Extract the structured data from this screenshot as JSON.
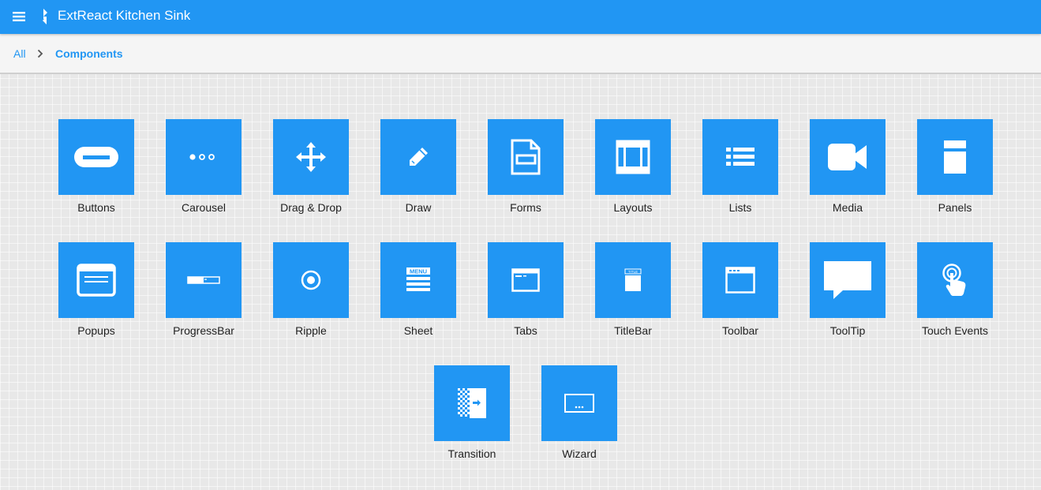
{
  "header": {
    "title": "ExtReact Kitchen Sink",
    "menu_icon": "menu-icon",
    "logo_icon": "sencha-logo-icon",
    "background_color": "#2196f3"
  },
  "breadcrumb": {
    "items": [
      {
        "label": "All"
      },
      {
        "label": "Components"
      }
    ],
    "separator_icon": "chevron-right-icon"
  },
  "components": {
    "accent_color": "#2196f3",
    "items": [
      {
        "label": "Buttons",
        "icon": "button-icon"
      },
      {
        "label": "Carousel",
        "icon": "carousel-icon"
      },
      {
        "label": "Drag & Drop",
        "icon": "drag-drop-icon"
      },
      {
        "label": "Draw",
        "icon": "pencil-icon"
      },
      {
        "label": "Forms",
        "icon": "form-icon"
      },
      {
        "label": "Layouts",
        "icon": "layout-icon"
      },
      {
        "label": "Lists",
        "icon": "list-icon"
      },
      {
        "label": "Media",
        "icon": "video-camera-icon"
      },
      {
        "label": "Panels",
        "icon": "panel-icon"
      },
      {
        "label": "Popups",
        "icon": "popup-icon"
      },
      {
        "label": "ProgressBar",
        "icon": "progressbar-icon"
      },
      {
        "label": "Ripple",
        "icon": "ripple-icon"
      },
      {
        "label": "Sheet",
        "icon": "sheet-menu-icon",
        "icon_text": "MENU"
      },
      {
        "label": "Tabs",
        "icon": "tabs-icon"
      },
      {
        "label": "TitleBar",
        "icon": "titlebar-icon",
        "icon_text": "TITLE"
      },
      {
        "label": "Toolbar",
        "icon": "toolbar-icon"
      },
      {
        "label": "ToolTip",
        "icon": "tooltip-icon"
      },
      {
        "label": "Touch Events",
        "icon": "touch-icon"
      },
      {
        "label": "Transition",
        "icon": "transition-icon"
      },
      {
        "label": "Wizard",
        "icon": "wizard-icon"
      }
    ]
  }
}
